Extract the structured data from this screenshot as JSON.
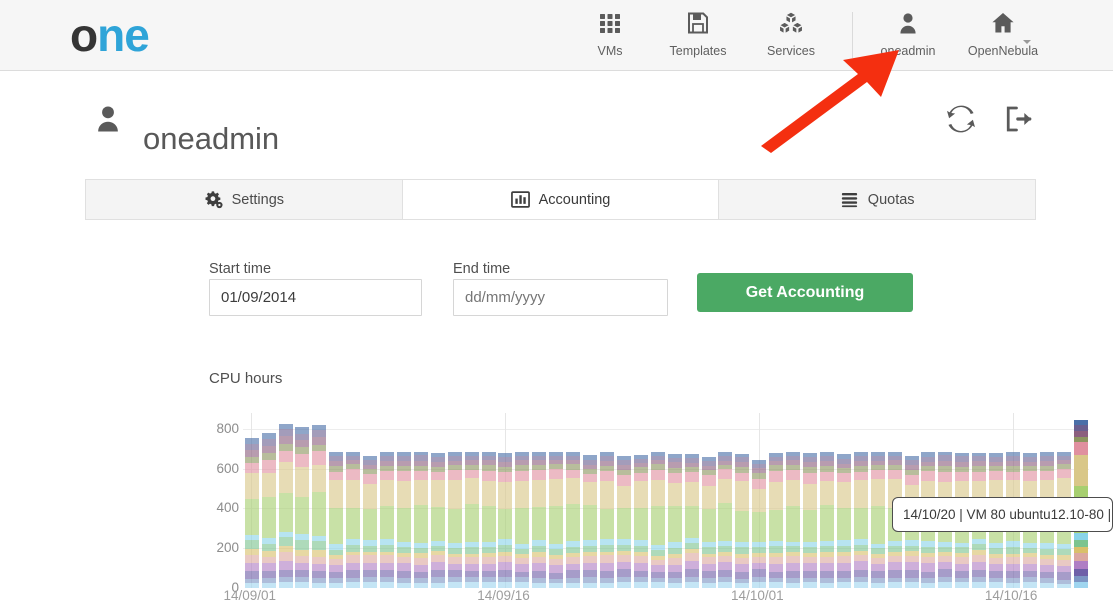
{
  "header": {
    "logo": {
      "part1": "o",
      "part2": "ne"
    },
    "nav_items": [
      {
        "label": "VMs",
        "icon": "grid-icon"
      },
      {
        "label": "Templates",
        "icon": "floppy-disk-icon"
      },
      {
        "label": "Services",
        "icon": "cubes-icon"
      }
    ],
    "user_nav": [
      {
        "label": "oneadmin",
        "icon": "user-icon"
      },
      {
        "label": "OpenNebula",
        "icon": "home-icon"
      }
    ]
  },
  "page": {
    "title": "oneadmin",
    "title_icon": "user-icon",
    "actions": [
      {
        "name": "refresh",
        "icon": "refresh-icon"
      },
      {
        "name": "sign-out",
        "icon": "sign-out-icon"
      }
    ]
  },
  "tabs": [
    {
      "label": "Settings",
      "icon": "gears-icon",
      "active": false
    },
    {
      "label": "Accounting",
      "icon": "bar-chart-icon",
      "active": true
    },
    {
      "label": "Quotas",
      "icon": "list-icon",
      "active": false
    }
  ],
  "form": {
    "start_time": {
      "label": "Start time",
      "value": "01/09/2014",
      "placeholder": "dd/mm/yyyy"
    },
    "end_time": {
      "label": "End time",
      "value": "",
      "placeholder": "dd/mm/yyyy"
    },
    "submit_label": "Get Accounting"
  },
  "tooltip": {
    "text": "14/10/20 | VM 80 ubuntu12.10-80 |"
  },
  "colors": {
    "brand_dark": "#353535",
    "brand_blue": "#2fa4d8",
    "button_green": "#4ba964",
    "header_bg": "#f6f6f6",
    "annotation_red": "#f42f10"
  },
  "chart_data": {
    "type": "bar",
    "stacked": true,
    "title": "CPU hours",
    "xlabel": "",
    "ylabel": "CPU hours",
    "ylim": [
      0,
      880
    ],
    "ytick_values": [
      0,
      200,
      400,
      600,
      800
    ],
    "ytick_labels": [
      "0",
      "200",
      "400",
      "600",
      "800"
    ],
    "xtick_indices": [
      0,
      15,
      30,
      45
    ],
    "xtick_labels": [
      "14/09/01",
      "14/09/16",
      "14/10/01",
      "14/10/16"
    ],
    "grid": true,
    "legend": "none",
    "n_bars": 50,
    "series_colors": [
      "#9fd5ef",
      "#7d95c4",
      "#6f5fa8",
      "#b07ec4",
      "#dba8a0",
      "#d9c06a",
      "#7cc48f",
      "#8ad4e8",
      "#a7cf70",
      "#d9c788",
      "#e0909f",
      "#8d9560",
      "#8c5f7e",
      "#6a5f8f",
      "#4a6fa8"
    ],
    "highlight_index": 49,
    "highlight_label": "14/10/20",
    "bar_totals": [
      785,
      795,
      828,
      827,
      818,
      685,
      684,
      686,
      685,
      684,
      686,
      685,
      684,
      686,
      685,
      684,
      686,
      685,
      684,
      686,
      685,
      684,
      686,
      685,
      684,
      686,
      685,
      684,
      686,
      685,
      684,
      686,
      685,
      684,
      686,
      685,
      684,
      686,
      685,
      684,
      686,
      685,
      684,
      686,
      685,
      684,
      686,
      685,
      684,
      845
    ],
    "note": "Stacked bars of CPU hours per day; each stack segment is one VM. First 5 days ~790-830 h, steady plateau ~685 h, final highlighted day 14/10/20 ~845 h."
  }
}
